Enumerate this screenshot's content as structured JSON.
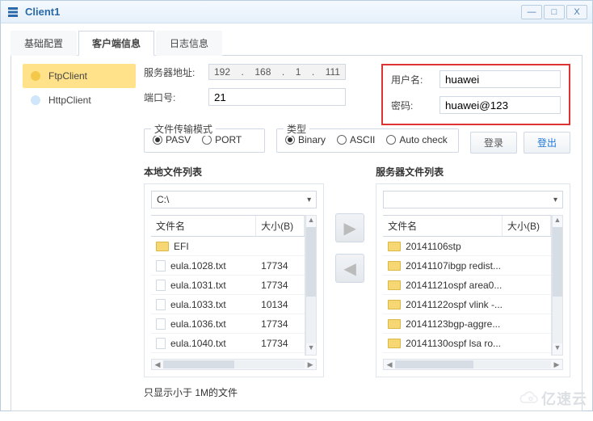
{
  "title": "Client1",
  "tabs": [
    "基础配置",
    "客户端信息",
    "日志信息"
  ],
  "active_tab": 1,
  "sidebar": {
    "items": [
      {
        "label": "FtpClient",
        "color": "#f4c94b"
      },
      {
        "label": "HttpClient",
        "color": "#cfe6fb"
      }
    ],
    "active_index": 0
  },
  "server": {
    "addr_label": "服务器地址:",
    "ip": [
      "192",
      "168",
      "1",
      "111"
    ],
    "port_label": "端口号:",
    "port": "21"
  },
  "auth": {
    "user_label": "用户名:",
    "user": "huawei",
    "pass_label": "密码:",
    "pass": "huawei@123"
  },
  "transfer_mode": {
    "legend": "文件传输模式",
    "options": [
      "PASV",
      "PORT"
    ],
    "selected": 0
  },
  "data_type": {
    "legend": "类型",
    "options": [
      "Binary",
      "ASCII",
      "Auto check"
    ],
    "selected": 0
  },
  "buttons": {
    "login": "登录",
    "logout": "登出"
  },
  "local_list": {
    "title": "本地文件列表",
    "path": "C:\\",
    "cols": [
      "文件名",
      "大小(B)"
    ],
    "rows": [
      {
        "name": "EFI",
        "size": "",
        "type": "folder"
      },
      {
        "name": "eula.1028.txt",
        "size": "17734",
        "type": "file"
      },
      {
        "name": "eula.1031.txt",
        "size": "17734",
        "type": "file"
      },
      {
        "name": "eula.1033.txt",
        "size": "10134",
        "type": "file"
      },
      {
        "name": "eula.1036.txt",
        "size": "17734",
        "type": "file"
      },
      {
        "name": "eula.1040.txt",
        "size": "17734",
        "type": "file"
      }
    ]
  },
  "server_list": {
    "title": "服务器文件列表",
    "path": "",
    "cols": [
      "文件名",
      "大小(B)"
    ],
    "rows": [
      {
        "name": "20141106stp",
        "size": "",
        "type": "folder"
      },
      {
        "name": "20141107ibgp redist...",
        "size": "",
        "type": "folder"
      },
      {
        "name": "20141121ospf area0...",
        "size": "",
        "type": "folder"
      },
      {
        "name": "20141122ospf vlink -...",
        "size": "",
        "type": "folder"
      },
      {
        "name": "20141123bgp-aggre...",
        "size": "",
        "type": "folder"
      },
      {
        "name": "20141130ospf lsa ro...",
        "size": "",
        "type": "folder"
      }
    ]
  },
  "note": "只显示小于 1M的文件",
  "watermark": "亿速云"
}
